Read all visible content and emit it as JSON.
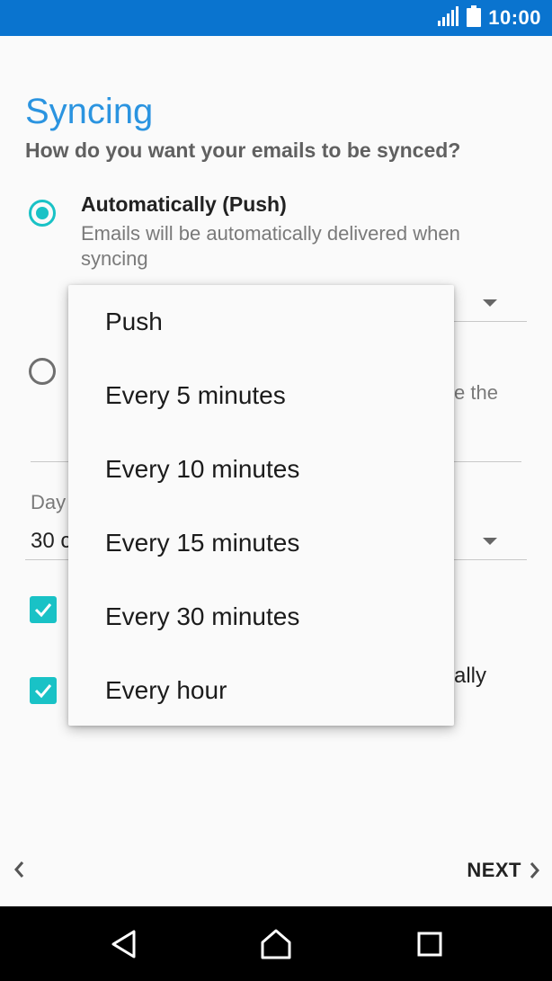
{
  "status_bar": {
    "time": "10:00",
    "icons": [
      "signal-icon",
      "battery-icon"
    ],
    "color": "#0a74cf"
  },
  "page": {
    "title": "Syncing",
    "subtitle": "How do you want your emails to be synced?"
  },
  "options": {
    "push": {
      "title": "Automatically (Push)",
      "description": "Emails will be automatically delivered when syncing",
      "selected": true
    },
    "manual": {
      "description_fragment": "e the",
      "selected": false
    }
  },
  "days_field": {
    "label_fragment": "Day",
    "value_fragment": "30 c"
  },
  "checkbox_fragment": "ally",
  "checkboxes": [
    {
      "checked": true
    },
    {
      "checked": true
    }
  ],
  "dropdown": {
    "items": [
      "Push",
      "Every 5 minutes",
      "Every 10 minutes",
      "Every 15 minutes",
      "Every 30 minutes",
      "Every hour"
    ]
  },
  "footer": {
    "back_icon": "chevron-left-icon",
    "next_label": "NEXT",
    "next_icon": "chevron-right-icon"
  },
  "nav_bar": {
    "icons": [
      "back-triangle-icon",
      "home-icon",
      "recents-icon"
    ]
  },
  "colors": {
    "accent": "#19c2c6",
    "title": "#2b94e0"
  }
}
